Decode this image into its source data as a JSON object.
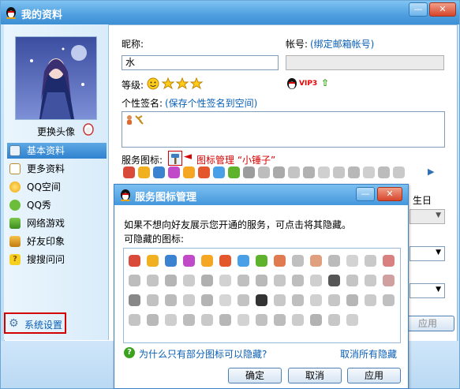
{
  "window": {
    "title": "我的资料"
  },
  "sidebar": {
    "change_avatar": "更换头像",
    "items": [
      {
        "label": "基本资料",
        "icon": "id-card-icon"
      },
      {
        "label": "更多资料",
        "icon": "document-icon"
      },
      {
        "label": "QQ空间",
        "icon": "qzone-icon"
      },
      {
        "label": "QQ秀",
        "icon": "qqshow-icon"
      },
      {
        "label": "网络游戏",
        "icon": "game-icon"
      },
      {
        "label": "好友印象",
        "icon": "impression-icon"
      },
      {
        "label": "搜搜问问",
        "icon": "question-icon"
      }
    ],
    "settings": "系统设置"
  },
  "profile": {
    "nickname_label": "昵称:",
    "nickname_value": "水",
    "account_label": "帐号:",
    "account_link": "(绑定邮箱帐号)",
    "level_label": "等级:",
    "vip_badge": "VIP3",
    "signature_label": "个性签名:",
    "signature_link": "(保存个性签名到空间)",
    "service_label": "服务图标:",
    "service_annotation": "图标管理 “小锤子”",
    "partial_right_text": "生日"
  },
  "dialog": {
    "title": "服务图标管理",
    "message": "如果不想向好友展示您开通的服务，可点击将其隐藏。",
    "hideable_label": "可隐藏的图标:",
    "help_link": "为什么只有部分图标可以隐藏?",
    "unhide_all": "取消所有隐藏",
    "ok": "确定",
    "cancel": "取消",
    "apply": "应用"
  },
  "main_apply": "应用",
  "colors": {
    "title_bar": "#4f9fe0",
    "selected_nav": "#2f82cf",
    "annotation_red": "#d40000",
    "link_blue": "#0a5fb5"
  }
}
